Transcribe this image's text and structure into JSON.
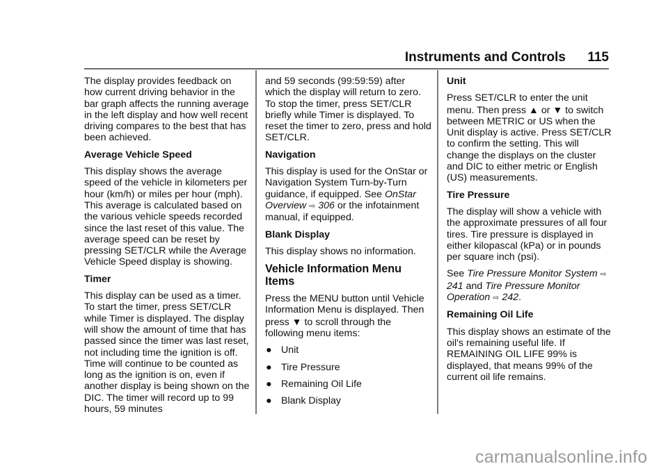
{
  "header": {
    "section_title": "Instruments and Controls",
    "page_number": "115"
  },
  "columns": {
    "col1": {
      "intro": "The display provides feedback on how current driving behavior in the bar graph affects the running average in the left display and how well recent driving compares to the best that has been achieved.",
      "avg_speed_heading": "Average Vehicle Speed",
      "avg_speed_body": "This display shows the average speed of the vehicle in kilometers per hour (km/h) or miles per hour (mph). This average is calculated based on the various vehicle speeds recorded since the last reset of this value. The average speed can be reset by pressing SET/CLR while the Average Vehicle Speed display is showing.",
      "timer_heading": "Timer",
      "timer_body": "This display can be used as a timer. To start the timer, press SET/CLR while Timer is displayed. The display will show the amount of time that has passed since the timer was last reset, not including time the ignition is off. Time will continue to be counted as long as the ignition is on, even if another display is being shown on the DIC. The timer will record up to 99 hours, 59 minutes"
    },
    "col2": {
      "timer_cont": "and 59 seconds (99:59:59) after which the display will return to zero. To stop the timer, press SET/CLR briefly while Timer is displayed. To reset the timer to zero, press and hold SET/CLR.",
      "nav_heading": "Navigation",
      "nav_body_a": "This display is used for the OnStar or Navigation System Turn-by-Turn guidance, if equipped. See ",
      "nav_link": "OnStar Overview",
      "nav_ref_arrow": "⇨",
      "nav_ref_page": "306",
      "nav_body_b": " or the infotainment manual, if equipped.",
      "blank_heading": "Blank Display",
      "blank_body": "This display shows no information.",
      "vim_heading": "Vehicle Information Menu Items",
      "vim_body_a": "Press the MENU button until Vehicle Information Menu is displayed. Then press ",
      "down_arrow": "▼",
      "vim_body_b": " to scroll through the following menu items:",
      "bullet_glyph": "●",
      "menu_items": [
        "Unit",
        "Tire Pressure",
        "Remaining Oil Life",
        "Blank Display"
      ]
    },
    "col3": {
      "unit_heading": "Unit",
      "unit_body_a": "Press SET/CLR to enter the unit menu. Then press ",
      "up_arrow": "▲",
      "unit_or": " or ",
      "down_arrow": "▼",
      "unit_body_b": " to switch between METRIC or US when the Unit display is active. Press SET/CLR to confirm the setting. This will change the displays on the cluster and DIC to either metric or English (US) measurements.",
      "tire_heading": "Tire Pressure",
      "tire_body": "The display will show a vehicle with the approximate pressures of all four tires. Tire pressure is displayed in either kilopascal (kPa) or in pounds per square inch (psi).",
      "tire_see": "See ",
      "tire_link1": "Tire Pressure Monitor System",
      "tire_ref_arrow": "⇨",
      "tire_ref1": "241",
      "tire_and": " and ",
      "tire_link2": "Tire Pressure Monitor Operation",
      "tire_ref2": "242",
      "tire_end": ".",
      "oil_heading": "Remaining Oil Life",
      "oil_body": "This display shows an estimate of the oil's remaining useful life. If REMAINING OIL LIFE 99% is displayed, that means 99% of the current oil life remains."
    }
  },
  "watermark": "carmanualsonline.info"
}
